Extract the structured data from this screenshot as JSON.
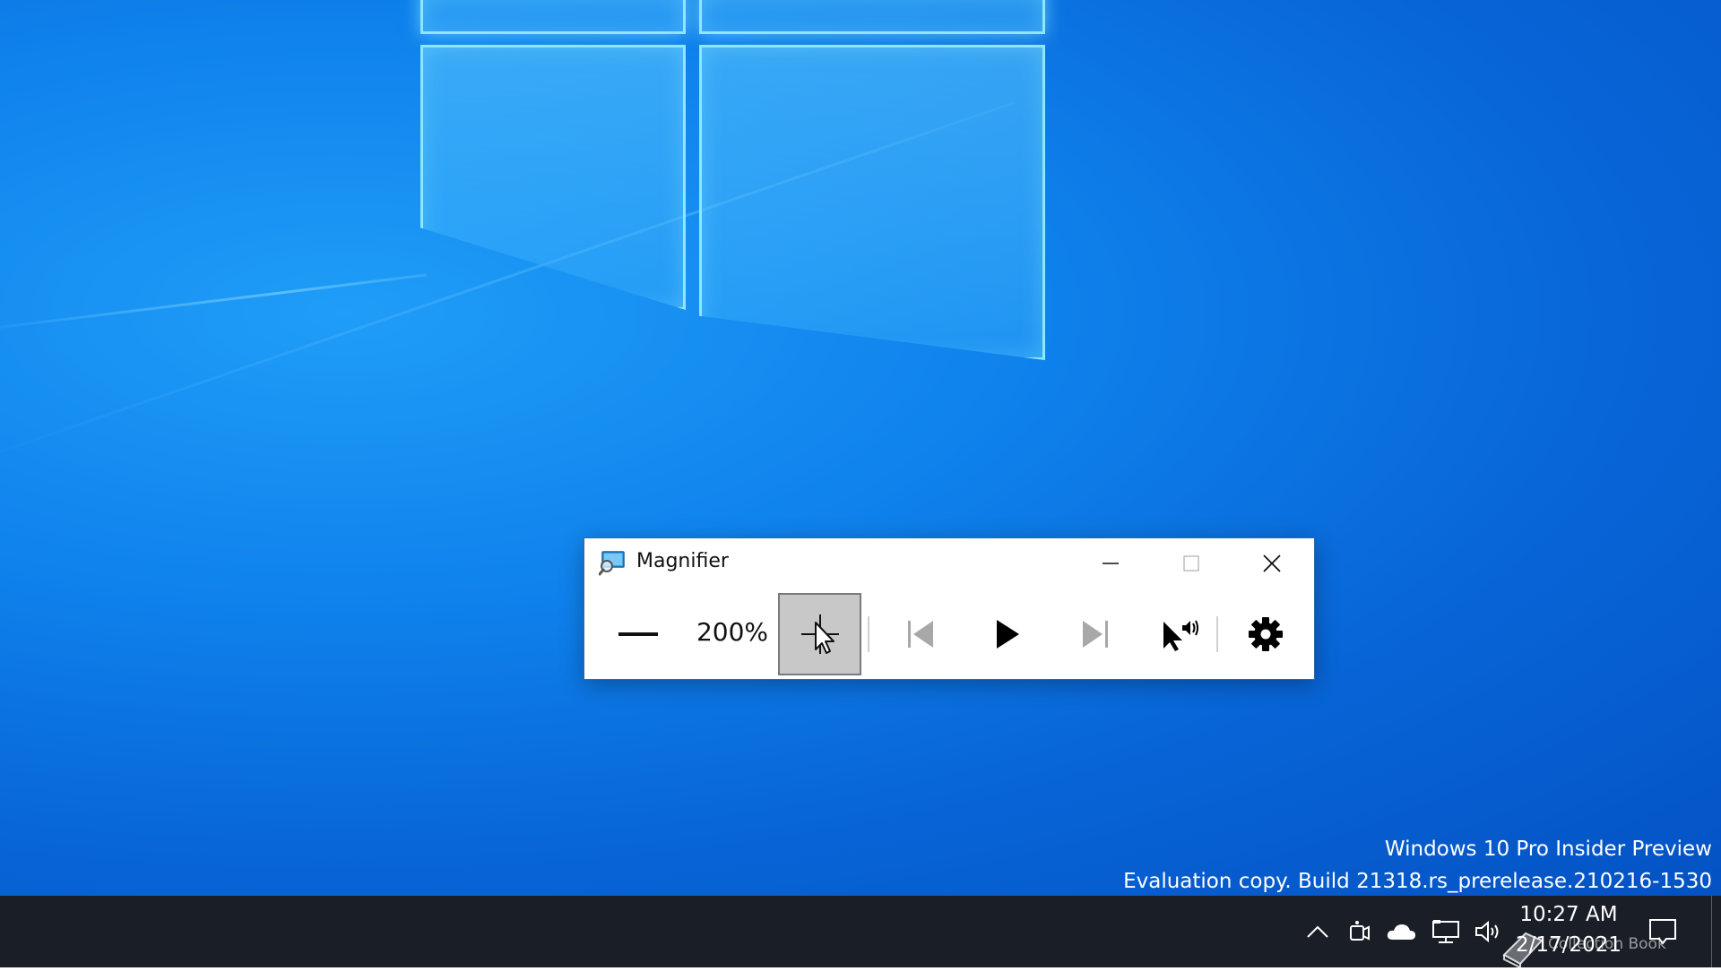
{
  "window": {
    "title": "Magnifier",
    "zoom_level": "200%"
  },
  "toolbar": {
    "icons": [
      "minus-icon",
      "cursor-move-icon",
      "previous-icon",
      "play-icon",
      "next-icon",
      "read-from-here-icon",
      "gear-icon"
    ]
  },
  "watermark": {
    "line1": "Windows 10 Pro Insider Preview",
    "line2": "Evaluation copy. Build 21318.rs_prerelease.210216-1530"
  },
  "taskbar": {
    "time": "10:27 AM",
    "date": "2/17/2021",
    "tray_icons": [
      "chevron-up-icon",
      "meet-now-icon",
      "onedrive-icon",
      "network-icon",
      "volume-icon"
    ],
    "badge_text": "Collection Book"
  },
  "colors": {
    "desktop": "#0a6fe0",
    "taskbar": "#1a1f27",
    "window_border": "#2a6aa8",
    "pressed_button": "#c8c8c8"
  }
}
